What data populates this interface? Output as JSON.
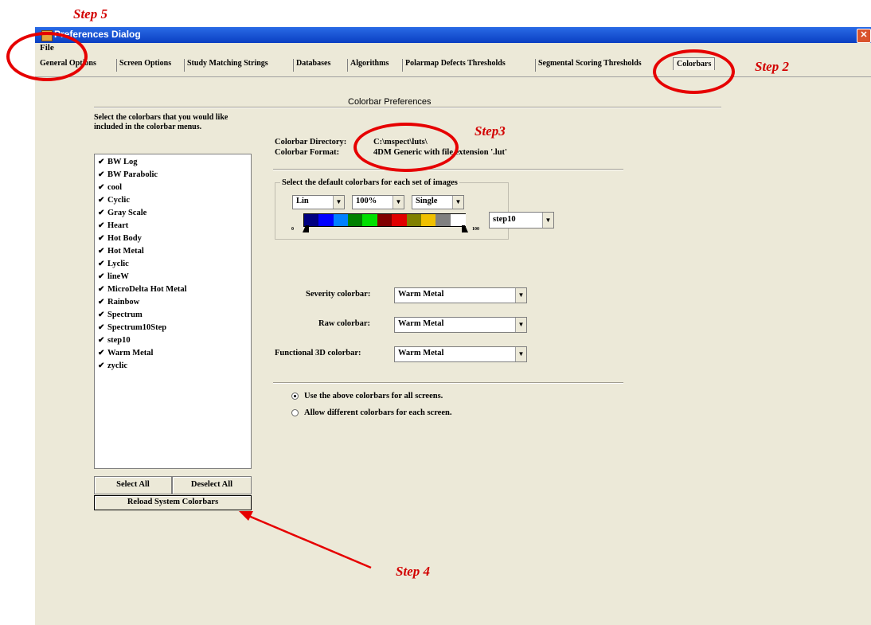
{
  "window": {
    "title": "Preferences Dialog",
    "close_glyph": "✕"
  },
  "menu": {
    "file": "File"
  },
  "tabs": [
    {
      "label": "General Options"
    },
    {
      "label": "Screen Options"
    },
    {
      "label": "Study Matching Strings"
    },
    {
      "label": "Databases"
    },
    {
      "label": "Algorithms"
    },
    {
      "label": "Polarmap Defects Thresholds"
    },
    {
      "label": "Segmental Scoring Thresholds"
    },
    {
      "label": "Colorbars",
      "active": true
    }
  ],
  "section_title": "Colorbar Preferences",
  "instructions": "Select the colorbars that you would like included in the colorbar menus.",
  "colorbar_list": [
    "BW Log",
    "BW Parabolic",
    "cool",
    "Cyclic",
    "Gray Scale",
    "Heart",
    "Hot Body",
    "Hot Metal",
    "Lyclic",
    "lineW",
    "MicroDelta Hot Metal",
    "Rainbow",
    "Spectrum",
    "Spectrum10Step",
    "step10",
    "Warm Metal",
    "zyclic"
  ],
  "checkbox_glyph": "✔",
  "buttons": {
    "select_all": "Select All",
    "deselect_all": "Deselect All",
    "reload": "Reload System Colorbars"
  },
  "directory": {
    "label": "Colorbar Directory:",
    "value": "C:\\mspect\\luts\\"
  },
  "format": {
    "label": "Colorbar Format:",
    "value": "4DM Generic with file extension '.lut'"
  },
  "defaults_group": {
    "title": "Select the default colorbars for each set of images",
    "scale": "Lin",
    "zoom": "100%",
    "mode": "Single",
    "colorbar": "step10",
    "range_min": "0",
    "range_max": "100"
  },
  "step10_colors": [
    "#000080",
    "#0000ff",
    "#0080ff",
    "#008000",
    "#00e000",
    "#800000",
    "#e00000",
    "#808000",
    "#f0c000",
    "#808080",
    "#ffffff"
  ],
  "severity": {
    "label": "Severity colorbar:",
    "value": "Warm Metal"
  },
  "raw": {
    "label": "Raw colorbar:",
    "value": "Warm Metal"
  },
  "functional": {
    "label": "Functional 3D colorbar:",
    "value": "Warm Metal"
  },
  "radio_all": "Use the above colorbars for all screens.",
  "radio_diff": "Allow different colorbars for each screen.",
  "dropdown_arrow": "▼",
  "annotations": {
    "step2": "Step 2",
    "step3": "Step3",
    "step4": "Step 4",
    "step5": "Step 5",
    "annotation_color": "#d20000"
  }
}
